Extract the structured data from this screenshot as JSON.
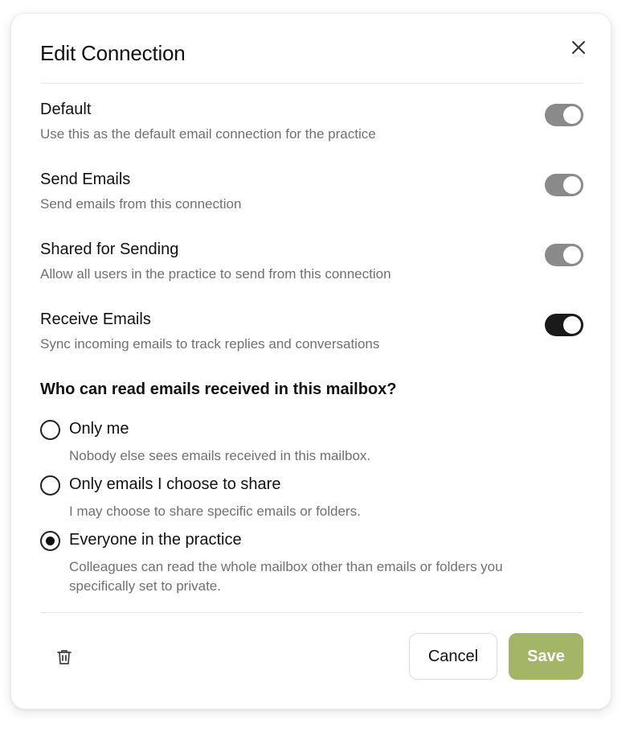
{
  "dialog": {
    "title": "Edit Connection"
  },
  "settings": [
    {
      "label": "Default",
      "description": "Use this as the default email connection for the practice",
      "enabled": true
    },
    {
      "label": "Send Emails",
      "description": "Send emails from this connection",
      "enabled": true
    },
    {
      "label": "Shared for Sending",
      "description": "Allow all users in the practice to send from this connection",
      "enabled": true
    },
    {
      "label": "Receive Emails",
      "description": "Sync incoming emails to track replies and conversations",
      "enabled": true
    }
  ],
  "read_access": {
    "question": "Who can read emails received in this mailbox?",
    "selected": "everyone",
    "options": [
      {
        "id": "only_me",
        "label": "Only me",
        "description": "Nobody else sees emails received in this mailbox."
      },
      {
        "id": "choose_to_share",
        "label": "Only emails I choose to share",
        "description": "I may choose to share specific emails or folders."
      },
      {
        "id": "everyone",
        "label": "Everyone in the practice",
        "description": "Colleagues can read the whole mailbox other than emails or folders you specifically set to private."
      }
    ]
  },
  "footer": {
    "cancel_label": "Cancel",
    "save_label": "Save"
  },
  "icons": {
    "close": "close-icon",
    "delete": "trash-icon"
  },
  "colors": {
    "save_button": "#a3b567",
    "toggle_on_dark": "#1a1a1a",
    "toggle_on_gray": "#8a8a8a",
    "description_text": "#707070"
  }
}
